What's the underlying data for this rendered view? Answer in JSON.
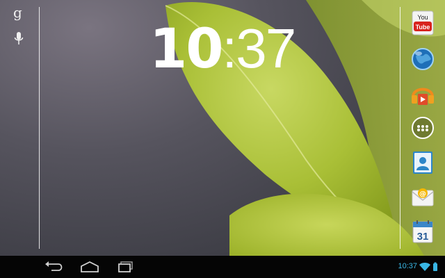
{
  "search": {
    "google_label": "g"
  },
  "clock": {
    "hours": "10",
    "separator": ":",
    "minutes": "37"
  },
  "dock": {
    "apps": [
      {
        "name": "YouTube",
        "label_top": "You",
        "label_bottom": "Tube",
        "icon": "youtube-icon"
      },
      {
        "name": "Browser",
        "icon": "browser-globe-icon"
      },
      {
        "name": "Play Music",
        "icon": "play-music-icon"
      },
      {
        "name": "All Apps",
        "icon": "all-apps-icon"
      },
      {
        "name": "Contacts",
        "icon": "contacts-icon"
      },
      {
        "name": "Email",
        "icon": "email-icon"
      },
      {
        "name": "Calendar",
        "day": "31",
        "icon": "calendar-icon"
      }
    ]
  },
  "status_bar": {
    "time": "10:37",
    "accent_color": "#39b6e5"
  },
  "navigation": {
    "buttons": [
      "back",
      "home",
      "recent-apps"
    ]
  }
}
